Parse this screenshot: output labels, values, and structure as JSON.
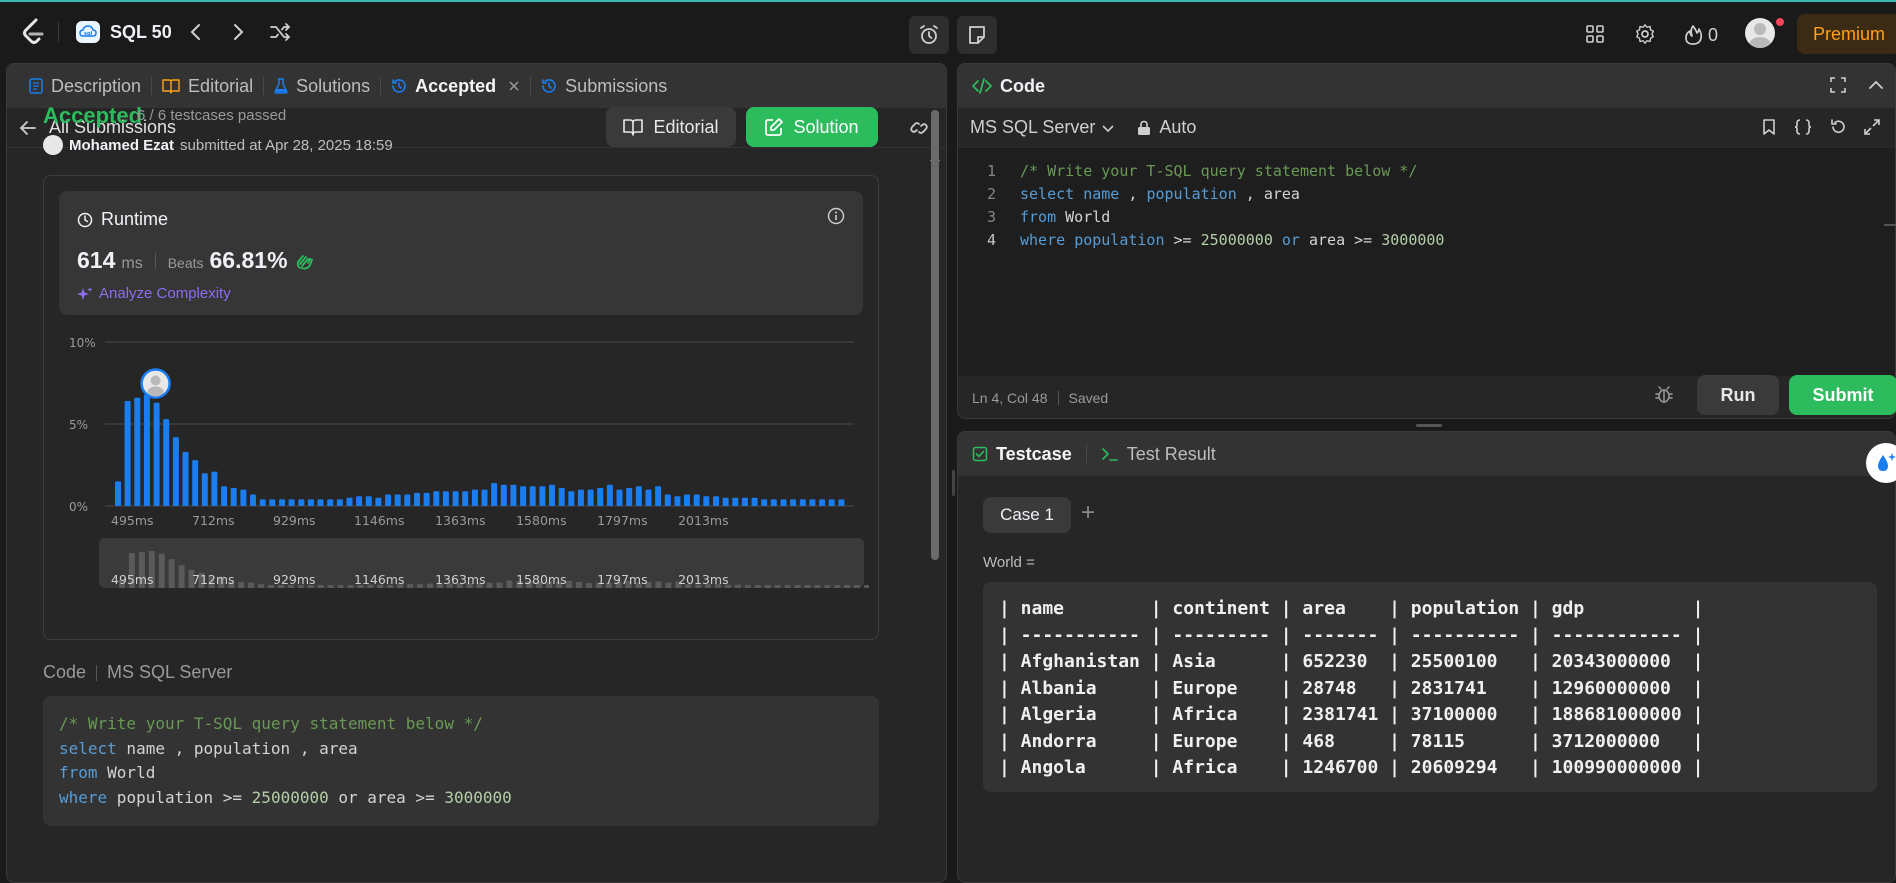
{
  "topbar": {
    "study_title": "SQL 50",
    "streak_count": "0",
    "premium_label": "Premium",
    "colors": {
      "accent": "#3fb8b2",
      "premium": "#ffa116"
    }
  },
  "left": {
    "tabs": [
      {
        "label": "Description",
        "icon": "description-icon"
      },
      {
        "label": "Editorial",
        "icon": "book-icon"
      },
      {
        "label": "Solutions",
        "icon": "flask-icon"
      },
      {
        "label": "Accepted",
        "icon": "history-icon",
        "active": true
      },
      {
        "label": "Submissions",
        "icon": "history-icon"
      }
    ],
    "back_label": "All Submissions",
    "status": "Accepted",
    "testcases": "6 / 6 testcases passed",
    "submitter_name": "Mohamed Ezat",
    "submitted_text": "submitted at Apr 28, 2025 18:59",
    "editorial_button": "Editorial",
    "solution_button": "Solution",
    "runtime": {
      "title": "Runtime",
      "value": "614",
      "unit": "ms",
      "beats_label": "Beats",
      "beats_value": "66.81%",
      "analyze_label": "Analyze Complexity"
    },
    "code_label": "Code",
    "code_lang": "MS SQL Server"
  },
  "chart_data": {
    "type": "bar",
    "y_ticks": [
      "10%",
      "5%",
      "0%"
    ],
    "ylim": [
      0,
      10
    ],
    "x_tick_labels": [
      "495ms",
      "712ms",
      "929ms",
      "1146ms",
      "1363ms",
      "1580ms",
      "1797ms",
      "2013ms"
    ],
    "values": [
      1.5,
      6.4,
      6.6,
      6.8,
      6.3,
      5.3,
      4.2,
      3.3,
      2.8,
      2.0,
      2.1,
      1.2,
      1.1,
      1.0,
      0.7,
      0.4,
      0.4,
      0.4,
      0.4,
      0.4,
      0.4,
      0.4,
      0.4,
      0.4,
      0.5,
      0.6,
      0.6,
      0.5,
      0.7,
      0.7,
      0.7,
      0.8,
      0.8,
      0.9,
      0.9,
      0.9,
      0.9,
      1.0,
      1.0,
      1.4,
      1.3,
      1.3,
      1.2,
      1.2,
      1.2,
      1.3,
      1.1,
      0.9,
      1.0,
      1.0,
      1.1,
      1.3,
      1.0,
      1.1,
      1.2,
      1.0,
      1.2,
      0.7,
      0.6,
      0.7,
      0.7,
      0.6,
      0.6,
      0.5,
      0.5,
      0.5,
      0.5,
      0.4,
      0.4,
      0.4,
      0.4,
      0.4,
      0.4,
      0.4,
      0.4,
      0.4
    ],
    "highlight_index": 3,
    "bar_color": "#1a7df0",
    "grid": true
  },
  "code_lines": [
    [
      {
        "t": "/* Write your T-SQL query statement below */",
        "c": "c-comment"
      }
    ],
    [
      {
        "t": "select",
        "c": "c-kw"
      },
      {
        "t": " name , population , area",
        "c": "c-plain"
      }
    ],
    [
      {
        "t": "from",
        "c": "c-kw"
      },
      {
        "t": " World",
        "c": "c-plain"
      }
    ],
    [
      {
        "t": "where",
        "c": "c-kw"
      },
      {
        "t": " population >= ",
        "c": "c-plain"
      },
      {
        "t": "25000000",
        "c": "c-num"
      },
      {
        "t": " or area >= ",
        "c": "c-plain"
      },
      {
        "t": "3000000",
        "c": "c-num"
      }
    ]
  ],
  "editor_lines": [
    [
      {
        "t": "/* Write your T-SQL query statement below */",
        "c": "c-comment"
      }
    ],
    [
      {
        "t": "select",
        "c": "c-kw"
      },
      {
        "t": " ",
        "c": "c-plain"
      },
      {
        "t": "name",
        "c": "c-kw"
      },
      {
        "t": " , ",
        "c": "c-plain"
      },
      {
        "t": "population",
        "c": "c-kw"
      },
      {
        "t": " , area",
        "c": "c-plain"
      }
    ],
    [
      {
        "t": "from",
        "c": "c-kw"
      },
      {
        "t": " World",
        "c": "c-plain"
      }
    ],
    [
      {
        "t": "where",
        "c": "c-kw"
      },
      {
        "t": " ",
        "c": "c-plain"
      },
      {
        "t": "population",
        "c": "c-kw"
      },
      {
        "t": " >= ",
        "c": "c-plain"
      },
      {
        "t": "25000000",
        "c": "c-num"
      },
      {
        "t": " ",
        "c": "c-plain"
      },
      {
        "t": "or",
        "c": "c-kw"
      },
      {
        "t": " area >= ",
        "c": "c-plain"
      },
      {
        "t": "3000000",
        "c": "c-num"
      }
    ]
  ],
  "right": {
    "code_title": "Code",
    "language": "MS SQL Server",
    "auto_label": "Auto",
    "cursor_pos": "Ln 4, Col 48",
    "saved_label": "Saved",
    "run_button": "Run",
    "submit_button": "Submit",
    "testcase_tab": "Testcase",
    "test_result_tab": "Test Result",
    "case_label": "Case 1",
    "input_label": "World =",
    "table_lines": [
      "| name        | continent | area    | population | gdp          |",
      "| ----------- | --------- | ------- | ---------- | ------------ |",
      "| Afghanistan | Asia      | 652230  | 25500100   | 20343000000  |",
      "| Albania     | Europe    | 28748   | 2831741    | 12960000000  |",
      "| Algeria     | Africa    | 2381741 | 37100000   | 188681000000 |",
      "| Andorra     | Europe    | 468     | 78115      | 3712000000   |",
      "| Angola      | Africa    | 1246700 | 20609294   | 100990000000 |"
    ]
  }
}
